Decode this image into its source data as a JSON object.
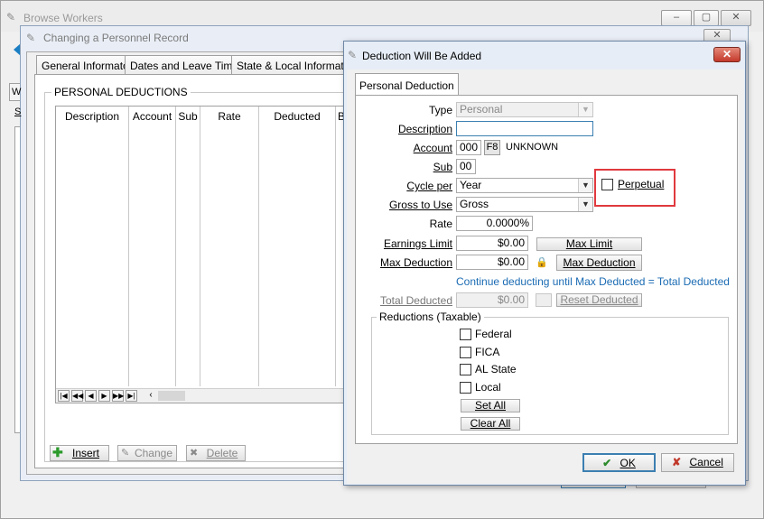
{
  "browse_workers": {
    "title": "Browse Workers"
  },
  "personnel_record": {
    "title": "Changing a Personnel Record",
    "tabs": [
      "General Informaton",
      "Dates and Leave Time",
      "State & Local Information"
    ],
    "section_title": "PERSONAL DEDUCTIONS",
    "columns": [
      "Description",
      "Account",
      "Sub",
      "Rate",
      "Deducted",
      "B"
    ],
    "buttons": {
      "insert": "Insert",
      "change": "Change",
      "delete": "Delete"
    },
    "nav_buttons": [
      "|◀",
      "◀◀",
      "◀",
      "▶",
      "▶▶",
      "▶|"
    ],
    "left_tab_fragment": "W",
    "left_label_fragment": "S"
  },
  "dialog": {
    "title": "Deduction Will Be Added",
    "close_label": "✕",
    "tab": "Personal Deduction",
    "fields": {
      "type_label": "Type",
      "type_value": "Personal",
      "description_label": "Description",
      "description_value": "",
      "account_label": "Account",
      "account_value": "000",
      "account_key": "F8",
      "account_name": "UNKNOWN",
      "sub_label": "Sub",
      "sub_value": "00",
      "cycle_label": "Cycle per",
      "cycle_value": "Year",
      "perpetual_label": "Perpetual",
      "gross_label": "Gross to Use",
      "gross_value": "Gross",
      "rate_label": "Rate",
      "rate_value": "0.0000%",
      "earnings_label": "Earnings Limit",
      "earnings_value": "$0.00",
      "max_limit_btn": "Max Limit",
      "maxded_label": "Max Deduction",
      "maxded_value": "$0.00",
      "max_deduction_btn": "Max Deduction",
      "continue_text": "Continue deducting until Max Deducted = Total Deducted",
      "total_label": "Total Deducted",
      "total_value": "$0.00",
      "reset_btn": "Reset Deducted"
    },
    "reductions": {
      "title": "Reductions (Taxable)",
      "items": [
        "Federal",
        "FICA",
        "AL State",
        "Local"
      ],
      "set_all": "Set All",
      "clear_all": "Clear All"
    },
    "ok_label": "OK",
    "cancel_label": "Cancel"
  },
  "colors": {
    "highlight_box": "#e0393e",
    "link_blue": "#1a6bb3",
    "ok_border": "#3c7fb1"
  }
}
